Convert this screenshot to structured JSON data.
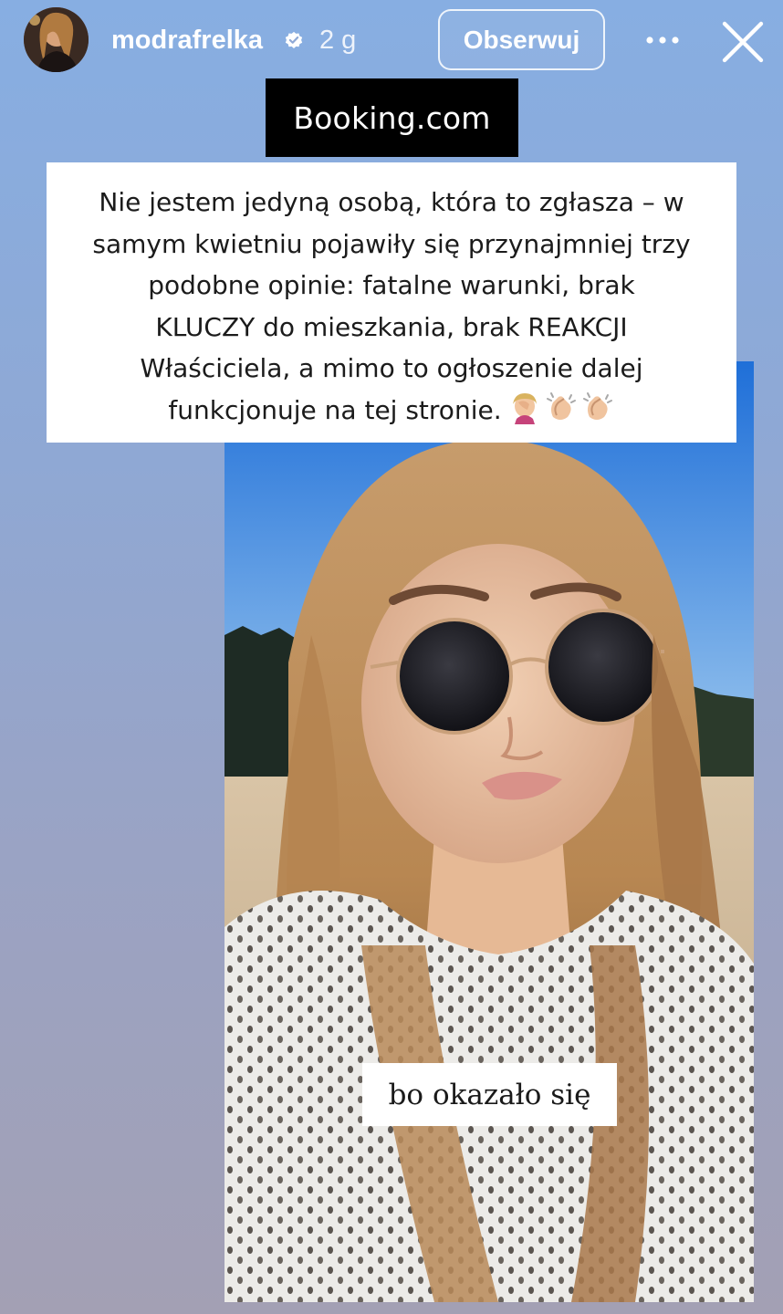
{
  "header": {
    "username": "modrafrelka",
    "time_ago": "2 g",
    "follow_label": "Obserwuj",
    "verified_icon": "verified-badge-icon",
    "more_icon": "more-options-icon",
    "close_icon": "close-icon"
  },
  "story": {
    "brand_label": "Booking.com",
    "quote_lines": [
      "Nie jestem jedyną osobą, która to zgłasza – w",
      "samym kwietniu pojawiły się przynajmniej trzy",
      "podobne opinie: fatalne warunki, brak",
      "KLUCZY do mieszkania, brak REAKCJI",
      "Właściciela, a mimo to ogłoszenie dalej",
      "funkcjonuje na tej stronie."
    ],
    "quote_emojis": [
      "facepalm-emoji",
      "clapping-hands-emoji",
      "clapping-hands-emoji"
    ],
    "caption": "bo okazało się"
  },
  "colors": {
    "background_top": "#87aee2",
    "background_bottom": "#a3a0b4",
    "label_bg": "#000000",
    "sticker_bg": "#ffffff"
  }
}
